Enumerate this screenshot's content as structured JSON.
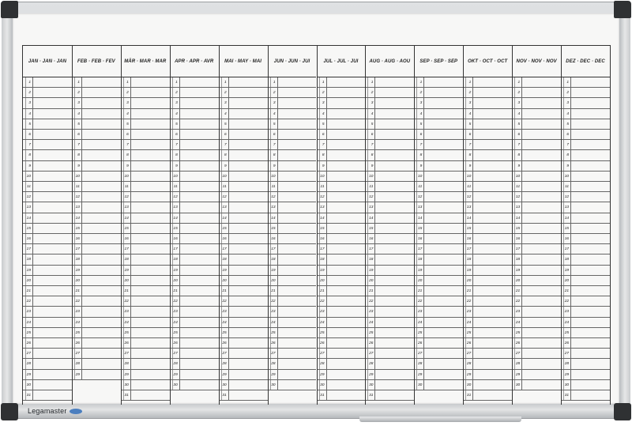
{
  "brand": {
    "name": "Legamaster",
    "mark": ""
  },
  "months": [
    {
      "label": "JAN · JAN · JAN",
      "days": 31
    },
    {
      "label": "FEB · FEB · FEV",
      "days": 29
    },
    {
      "label": "MÄR · MAR · MAR",
      "days": 31
    },
    {
      "label": "APR · APR · AVR",
      "days": 30
    },
    {
      "label": "MAI · MAY · MAI",
      "days": 31
    },
    {
      "label": "JUN · JUN · JUI",
      "days": 30
    },
    {
      "label": "JUL · JUL · JUI",
      "days": 31
    },
    {
      "label": "AUG · AUG · AOU",
      "days": 31
    },
    {
      "label": "SEP · SEP · SEP",
      "days": 30
    },
    {
      "label": "OKT · OCT · OCT",
      "days": 31
    },
    {
      "label": "NOV · NOV · NOV",
      "days": 30
    },
    {
      "label": "DEZ · DEC · DEC",
      "days": 31
    }
  ],
  "colors": {
    "frame": "#c8cbcd",
    "corner": "#2f3133",
    "surface": "#f7f7f6",
    "line": "#333333",
    "brandMark": "#4c7fbf"
  }
}
